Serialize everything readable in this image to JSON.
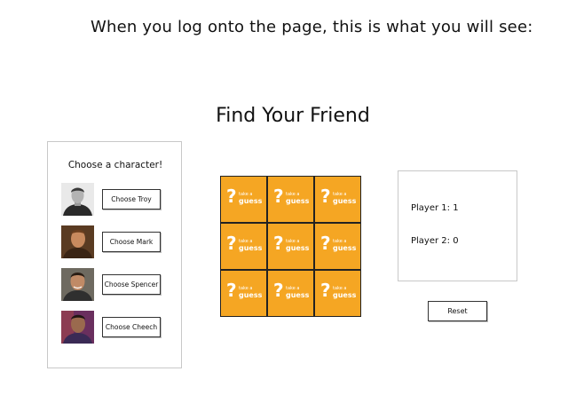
{
  "intro_text": "When you log onto the page, this is what you will see:",
  "page_title": "Find Your Friend",
  "character_panel": {
    "heading": "Choose a character!",
    "characters": [
      {
        "name": "Troy",
        "button_label": "Choose Troy"
      },
      {
        "name": "Mark",
        "button_label": "Choose Mark"
      },
      {
        "name": "Spencer",
        "button_label": "Choose Spencer"
      },
      {
        "name": "Cheech",
        "button_label": "Choose Cheech"
      }
    ]
  },
  "board": {
    "tile_color": "#f5a623",
    "tiles": [
      {
        "icon": "question-mark-icon",
        "line1": "take a",
        "line2": "guess"
      },
      {
        "icon": "question-mark-icon",
        "line1": "take a",
        "line2": "guess"
      },
      {
        "icon": "question-mark-icon",
        "line1": "take a",
        "line2": "guess"
      },
      {
        "icon": "question-mark-icon",
        "line1": "take a",
        "line2": "guess"
      },
      {
        "icon": "question-mark-icon",
        "line1": "take a",
        "line2": "guess"
      },
      {
        "icon": "question-mark-icon",
        "line1": "take a",
        "line2": "guess"
      },
      {
        "icon": "question-mark-icon",
        "line1": "take a",
        "line2": "guess"
      },
      {
        "icon": "question-mark-icon",
        "line1": "take a",
        "line2": "guess"
      },
      {
        "icon": "question-mark-icon",
        "line1": "take a",
        "line2": "guess"
      }
    ]
  },
  "scoreboard": {
    "player1": "Player 1: 1",
    "player2": "Player 2: 0"
  },
  "reset_label": "Reset"
}
